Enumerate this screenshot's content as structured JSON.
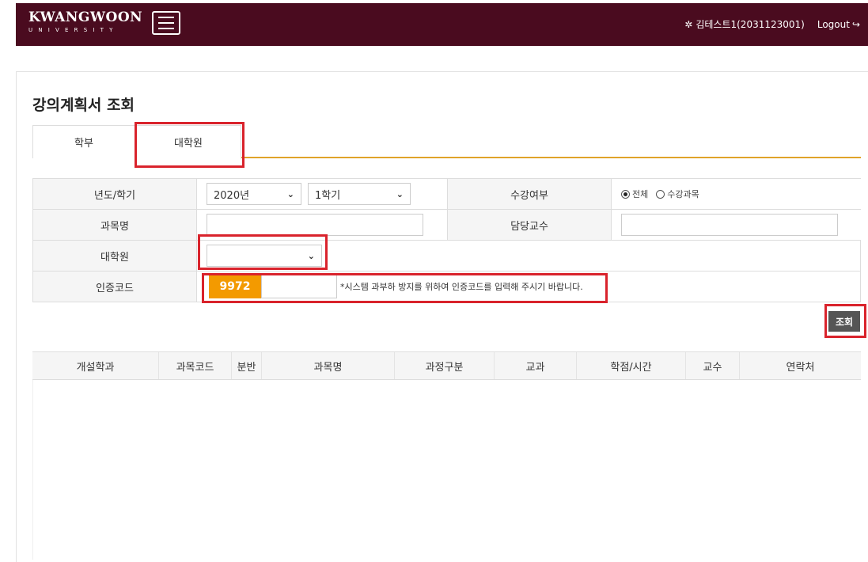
{
  "header": {
    "logo_main": "KWANGWOON",
    "logo_sub": "UNIVERSITY",
    "user": "김테스트1(2031123001)",
    "logout": "Logout",
    "bg_color": "#4a0b1f"
  },
  "page": {
    "title": "강의계획서 조회",
    "tabs": [
      {
        "label": "학부"
      },
      {
        "label": "대학원"
      }
    ]
  },
  "form": {
    "year_semester_label": "년도/학기",
    "year_value": "2020년",
    "semester_value": "1학기",
    "enroll_label": "수강여부",
    "radio_all": "전체",
    "radio_enrolled": "수강과목",
    "subject_label": "과목명",
    "professor_label": "담당교수",
    "grad_label": "대학원",
    "grad_value": "",
    "auth_label": "인증코드",
    "auth_code": "9972",
    "auth_notice": "*시스템 과부하 방지를 위하여 인증코드를 입력해 주시기 바랍니다.",
    "search_button": "조회"
  },
  "grid": {
    "columns": [
      "개설학과",
      "과목코드",
      "분반",
      "과목명",
      "과정구분",
      "교과",
      "학점/시간",
      "교수",
      "연락처"
    ],
    "rows": []
  },
  "colors": {
    "accent": "#e0a32a",
    "code_badge": "#f39a00",
    "highlight": "#d9232c"
  }
}
